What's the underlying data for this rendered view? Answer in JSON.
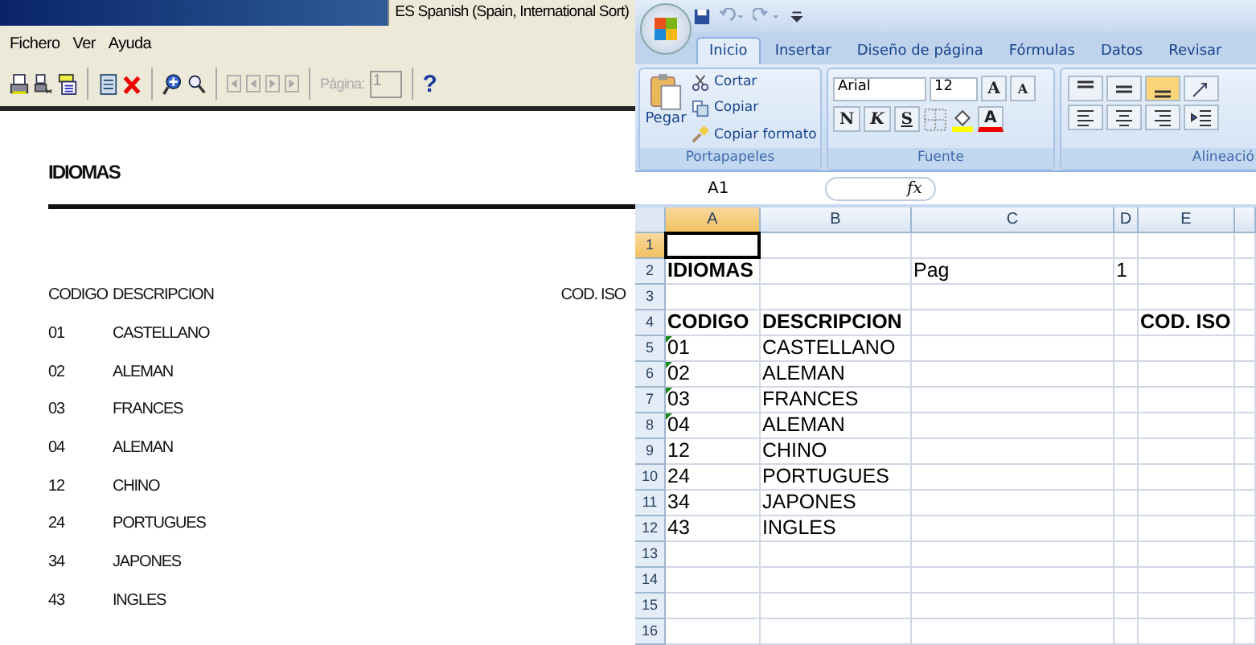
{
  "report_viewer": {
    "language_indicator": "ES Spanish (Spain, International Sort)",
    "menu": [
      "Fichero",
      "Ver",
      "Ayuda"
    ],
    "toolbar": {
      "page_label": "Página:",
      "page_value": "1",
      "help": "?"
    },
    "report": {
      "title": "IDIOMAS",
      "columns": [
        "CODIGO",
        "DESCRIPCION",
        "COD. ISO"
      ],
      "rows": [
        {
          "code": "01",
          "description": "CASTELLANO"
        },
        {
          "code": "02",
          "description": "ALEMAN"
        },
        {
          "code": "03",
          "description": "FRANCES"
        },
        {
          "code": "04",
          "description": "ALEMAN"
        },
        {
          "code": "12",
          "description": "CHINO"
        },
        {
          "code": "24",
          "description": "PORTUGUES"
        },
        {
          "code": "34",
          "description": "JAPONES"
        },
        {
          "code": "43",
          "description": "INGLES"
        }
      ]
    }
  },
  "excel": {
    "tabs": [
      {
        "label": "Inicio",
        "selected": true
      },
      {
        "label": "Insertar",
        "selected": false
      },
      {
        "label": "Diseño de página",
        "selected": false
      },
      {
        "label": "Fórmulas",
        "selected": false
      },
      {
        "label": "Datos",
        "selected": false
      },
      {
        "label": "Revisar",
        "selected": false
      }
    ],
    "clipboard": {
      "paste": "Pegar",
      "cut": "Cortar",
      "copy": "Copiar",
      "format_painter": "Copiar formato",
      "group": "Portapapeles"
    },
    "font": {
      "name": "Arial",
      "size": "12",
      "bold": "N",
      "italic": "K",
      "underline": "S",
      "grow": "A",
      "shrink": "A",
      "font_color_button": "A",
      "group": "Fuente"
    },
    "alignment": {
      "group": "Alineació"
    },
    "name_box": "A1",
    "fx": "fx",
    "columns": [
      {
        "label": "A",
        "selected": true
      },
      {
        "label": "B",
        "selected": false
      },
      {
        "label": "C",
        "selected": false
      },
      {
        "label": "D",
        "selected": false
      },
      {
        "label": "E",
        "selected": false
      }
    ],
    "rows": [
      {
        "number": "1",
        "selected": true,
        "cells": [
          null,
          null,
          null,
          null,
          null
        ]
      },
      {
        "number": "2",
        "selected": false,
        "cells": [
          {
            "text": "IDIOMAS",
            "bold": true
          },
          null,
          {
            "text": "Pag",
            "bold": false
          },
          {
            "text": "1",
            "bold": false
          },
          null
        ]
      },
      {
        "number": "3",
        "selected": false,
        "cells": [
          null,
          null,
          null,
          null,
          null
        ]
      },
      {
        "number": "4",
        "selected": false,
        "cells": [
          {
            "text": "CODIGO",
            "bold": true
          },
          {
            "text": "DESCRIPCION",
            "bold": true
          },
          null,
          null,
          {
            "text": "COD. ISO",
            "bold": true
          }
        ]
      },
      {
        "number": "5",
        "selected": false,
        "cells": [
          {
            "text": "01",
            "bold": false,
            "warning": true
          },
          {
            "text": "CASTELLANO",
            "bold": false
          },
          null,
          null,
          null
        ]
      },
      {
        "number": "6",
        "selected": false,
        "cells": [
          {
            "text": "02",
            "bold": false,
            "warning": true
          },
          {
            "text": "ALEMAN",
            "bold": false
          },
          null,
          null,
          null
        ]
      },
      {
        "number": "7",
        "selected": false,
        "cells": [
          {
            "text": "03",
            "bold": false,
            "warning": true
          },
          {
            "text": "FRANCES",
            "bold": false
          },
          null,
          null,
          null
        ]
      },
      {
        "number": "8",
        "selected": false,
        "cells": [
          {
            "text": "04",
            "bold": false,
            "warning": true
          },
          {
            "text": "ALEMAN",
            "bold": false
          },
          null,
          null,
          null
        ]
      },
      {
        "number": "9",
        "selected": false,
        "cells": [
          {
            "text": "12",
            "bold": false
          },
          {
            "text": "CHINO",
            "bold": false
          },
          null,
          null,
          null
        ]
      },
      {
        "number": "10",
        "selected": false,
        "cells": [
          {
            "text": "24",
            "bold": false
          },
          {
            "text": "PORTUGUES",
            "bold": false
          },
          null,
          null,
          null
        ]
      },
      {
        "number": "11",
        "selected": false,
        "cells": [
          {
            "text": "34",
            "bold": false
          },
          {
            "text": "JAPONES",
            "bold": false
          },
          null,
          null,
          null
        ]
      },
      {
        "number": "12",
        "selected": false,
        "cells": [
          {
            "text": "43",
            "bold": false
          },
          {
            "text": "INGLES",
            "bold": false
          },
          null,
          null,
          null
        ]
      },
      {
        "number": "13",
        "selected": false,
        "cells": [
          null,
          null,
          null,
          null,
          null
        ]
      },
      {
        "number": "14",
        "selected": false,
        "cells": [
          null,
          null,
          null,
          null,
          null
        ]
      },
      {
        "number": "15",
        "selected": false,
        "cells": [
          null,
          null,
          null,
          null,
          null
        ]
      },
      {
        "number": "16",
        "selected": false,
        "cells": [
          null,
          null,
          null,
          null,
          null
        ]
      }
    ]
  }
}
